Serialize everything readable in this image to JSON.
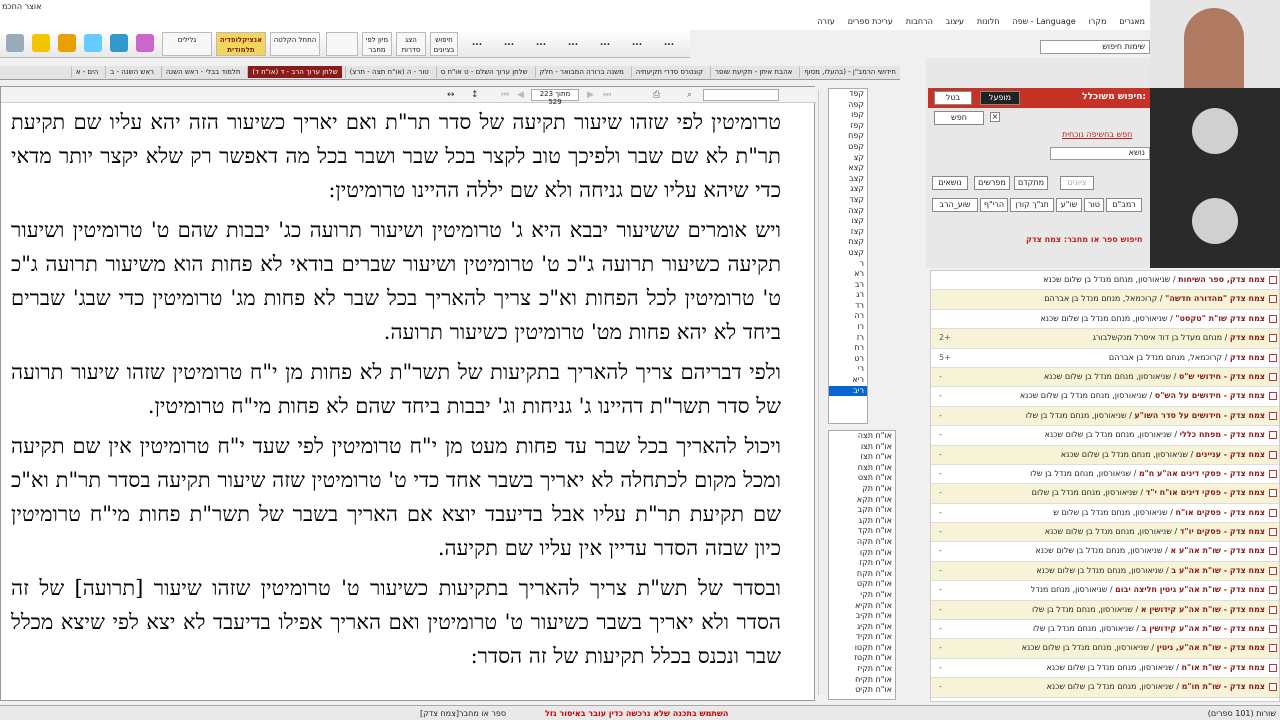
{
  "window": {
    "title": "אוצר החכמ"
  },
  "menu": [
    "מאגרים",
    "מקרו",
    "Language - שפה",
    "חלונות",
    "עיצוב",
    "הרחבות",
    "עריכת ספרים",
    "עזרה"
  ],
  "toolbar": {
    "buttons": [
      "חיפוש בציונים",
      "הצג סדרות",
      "מיון לפי מחבר",
      "",
      "התחל הקלטה",
      "",
      "אנציקלופדיה תלמודית",
      "גלילים"
    ],
    "dots": "..."
  },
  "tabs": [
    "חידושי הרמב\"ן - (בהעלו, מסוף",
    "אהבת איתן - תקיעת שופר",
    "קונטרס סדרי תקיעתיה",
    "משנה ברורה המבואר - חלק",
    "שלחן ערוך השלם - ט או\"ח ס",
    "טור - ה (או\"ח תצה - תרצ)",
    "שלחן ערוך הרב - ד (או\"ח ד)",
    "תלמוד בבלי - ראש השנה",
    "ראש השנה - ב",
    "הים - א"
  ],
  "doc": {
    "page": "223 מתוך 529",
    "paragraphs": [
      "טרומיטין לפי שזהו שיעור תקיעה של סדר תר\"ת ואם יאריך כשיעור הזה יהא עליו שם תקיעת תר\"ת לא שם שבר ולפיכך טוב לקצר בכל שבר ושבר בכל מה דאפשר רק שלא יקצר יותר מדאי כדי שיהא עליו שם גניחה ולא שם יללה ההיינו טרומיטין:",
      "ויש אומרים ששיעור יבבא היא ג' טרומיטין ושיעור תרועה כג' יבבות שהם ט' טרומיטין ושיעור תקיעה כשיעור תרועה ג\"כ ט' טרומיטין ושיעור שברים בודאי לא פחות הוא משיעור תרועה ג\"כ ט' טרומיטין לכל הפחות וא\"כ צריך להאריך בכל שבר לא פחות מג' טרומיטין כדי שבג' שברים ביחד לא יהא פחות מט' טרומיטין כשיעור תרועה.",
      "ולפי דבריהם צריך להאריך בתקיעות של תשר\"ת לא פחות מן י\"ח טרומיטין שזהו שיעור תרועה של סדר תשר\"ת דהיינו ג' גניחות וג' יבבות ביחד שהם לא פחות מי\"ח טרומיטין.",
      "ויכול להאריך בכל שבר עד פחות מעט מן י\"ח טרומיטין לפי שעד י\"ח טרומיטין אין שם תקיעה ומכל מקום לכתחלה לא יאריך בשבר אחד כדי ט' טרומיטין שזה שיעור תקיעה בסדר תר\"ת וא\"כ שם תקיעת תר\"ת עליו אבל בדיעבד יוצא אם האריך בשבר של תשר\"ת פחות מי\"ח טרומיטין כיון שבזה הסדר עדיין אין עליו שם תקיעה.",
      "ובסדר של תש\"ת צריך להאריך בתקיעות כשיעור ט' טרומיטין שזהו שיעור [תרועה] של זה הסדר ולא יאריך בשבר כשיעור ט' טרומיטין ואם האריך אפילו בדיעבד לא יצא לפי שיצא מכלל שבר ונכנס בכלל תקיעות של זה הסדר:"
    ]
  },
  "list1": [
    "קפד",
    "קפה",
    "קפו",
    "קפז",
    "קפח",
    "קפט",
    "קצ",
    "קצא",
    "קצב",
    "קצג",
    "קצד",
    "קצה",
    "קצו",
    "קצז",
    "קצח",
    "קצט",
    "ר",
    "רא",
    "רב",
    "רג",
    "רד",
    "רה",
    "רו",
    "רז",
    "רח",
    "רט",
    "רי",
    "ריא",
    "ריב"
  ],
  "list2": [
    "או\"ח תצה",
    "או\"ח תצו",
    "או\"ח תצז",
    "או\"ח תצח",
    "או\"ח תצט",
    "או\"ח תק",
    "או\"ח תקא",
    "או\"ח תקב",
    "או\"ח תקג",
    "או\"ח תקד",
    "או\"ח תקה",
    "או\"ח תקו",
    "או\"ח תקז",
    "או\"ח תקח",
    "או\"ח תקט",
    "או\"ח תקי",
    "או\"ח תקיא",
    "או\"ח תקיב",
    "או\"ח תקיג",
    "או\"ח תקיד",
    "או\"ח תקטו",
    "או\"ח תקטז",
    "או\"ח תקיז",
    "או\"ח תקיח",
    "או\"ח תקיט"
  ],
  "panel": {
    "search_label": "שימות חיפוש",
    "advanced_title": "חיפוש משוכלל:",
    "apply": "מופעל",
    "cancel": "בטל",
    "search": "חפש",
    "current_search_link": "חפש בחשיפה נוכחית",
    "subject": "נושא",
    "filters": [
      "ציונים",
      "מתקדם",
      "מפרשים",
      "נושאים"
    ],
    "sub_filters": [
      "רמב\"ם",
      "טור",
      "שו\"ע",
      "תנ\"ך קורן",
      "הרי\"ף",
      "שוע_הרב"
    ],
    "author_query": "חיפוש ספר או מחבר: צמח צדק"
  },
  "results": [
    {
      "title": "צמח צדק, ספר השיחות",
      "author": "שניאורסון, מנחם מנדל בן שלום שכנא",
      "count": ""
    },
    {
      "title": "צמח צדק \"מהדורה חדשה\"",
      "author": "קרוכמאל, מנחם מנדל בן אברהם",
      "count": ""
    },
    {
      "title": "צמח צדק שו\"ת \"טקסט\"",
      "author": "שניאורסון, מנחם מנדל בן שלום שכנא",
      "count": ""
    },
    {
      "title": "צמח צדק",
      "author": "מנחם מעדל בן דוד איסרל מנקשלבורג",
      "count": "+2"
    },
    {
      "title": "צמח צדק",
      "author": "קרוכמאל, מנחם מנדל בן אברהם",
      "count": "+5"
    },
    {
      "title": "צמח צדק - חידושי ש\"ס",
      "author": "שניאורסון, מנחם מנדל בן שלום שכנא",
      "count": "-"
    },
    {
      "title": "צמח צדק - חידושים על הש\"ס",
      "author": "שניאורסון, מנחם מנדל בן שלום שכנא",
      "count": "-"
    },
    {
      "title": "צמח צדק - חידושים על סדר השו\"ע",
      "author": "שניאורסון, מנחם מנדל בן שלו",
      "count": "-"
    },
    {
      "title": "צמח צדק - מפתח כללי",
      "author": "שניאורסון, מנחם מנדל בן שלום שכנא",
      "count": "-"
    },
    {
      "title": "צמח צדק - עניינים",
      "author": "שניאורסון, מנחם מנדל בן שלום שכנא",
      "count": "-"
    },
    {
      "title": "צמח צדק - פסקי דינים אה\"ע ח\"מ",
      "author": "שניאורסון, מנחם מנדל בן שלו",
      "count": "-"
    },
    {
      "title": "צמח צדק - פסקי דינים או\"ח י\"ד",
      "author": "שניאורסון, מנחם מנדל בן שלום",
      "count": "-"
    },
    {
      "title": "צמח צדק - פסקים או\"ח",
      "author": "שניאורסון, מנחם מנדל בן שלום ש",
      "count": "-"
    },
    {
      "title": "צמח צדק - פסקים יו\"ד",
      "author": "שניאורסון, מנחם מנדל בן שלום שכנא",
      "count": "-"
    },
    {
      "title": "צמח צדק - שו\"ת אה\"ע א",
      "author": "שניאורסון, מנחם מנדל בן שלום שכנא",
      "count": "-"
    },
    {
      "title": "צמח צדק - שו\"ת אה\"ע ב",
      "author": "שניאורסון, מנחם מנדל בן שלום שכנא",
      "count": "-"
    },
    {
      "title": "צמח צדק - שו\"ת אה\"ע גיטין חליצה יבום",
      "author": "שניאורסון, מנחם מנדל",
      "count": "-"
    },
    {
      "title": "צמח צדק - שו\"ת אה\"ע קידושין א",
      "author": "שניאורסון, מנחם מנדל בן שלו",
      "count": "-"
    },
    {
      "title": "צמח צדק - שו\"ת אה\"ע קידושין ב",
      "author": "שניאורסון, מנחם מנדל בן שלו",
      "count": "-"
    },
    {
      "title": "צמח צדק - שו\"ת אה\"ע, גיטין",
      "author": "שניאורסון, מנחם מנדל בן שלום שכנא",
      "count": "-"
    },
    {
      "title": "צמח צדק - שו\"ת או\"ח",
      "author": "שניאורסון, מנחם מנדל בן שלום שכנא",
      "count": "-"
    },
    {
      "title": "צמח צדק - שו\"ת חו\"מ",
      "author": "שניאורסון, מנחם מנדל בן שלום שכנא",
      "count": "-"
    }
  ],
  "status": {
    "left": "[צמח צדק]ספר או מחבר",
    "warning": "השתמש בתכנה שלא נרכשה כדין עובר באיסור גזל",
    "right": "שורות (101 ספרים)"
  },
  "colors": {
    "accent": "#8b1b1b",
    "selected": "#0a64d2",
    "header": "#c73226"
  }
}
